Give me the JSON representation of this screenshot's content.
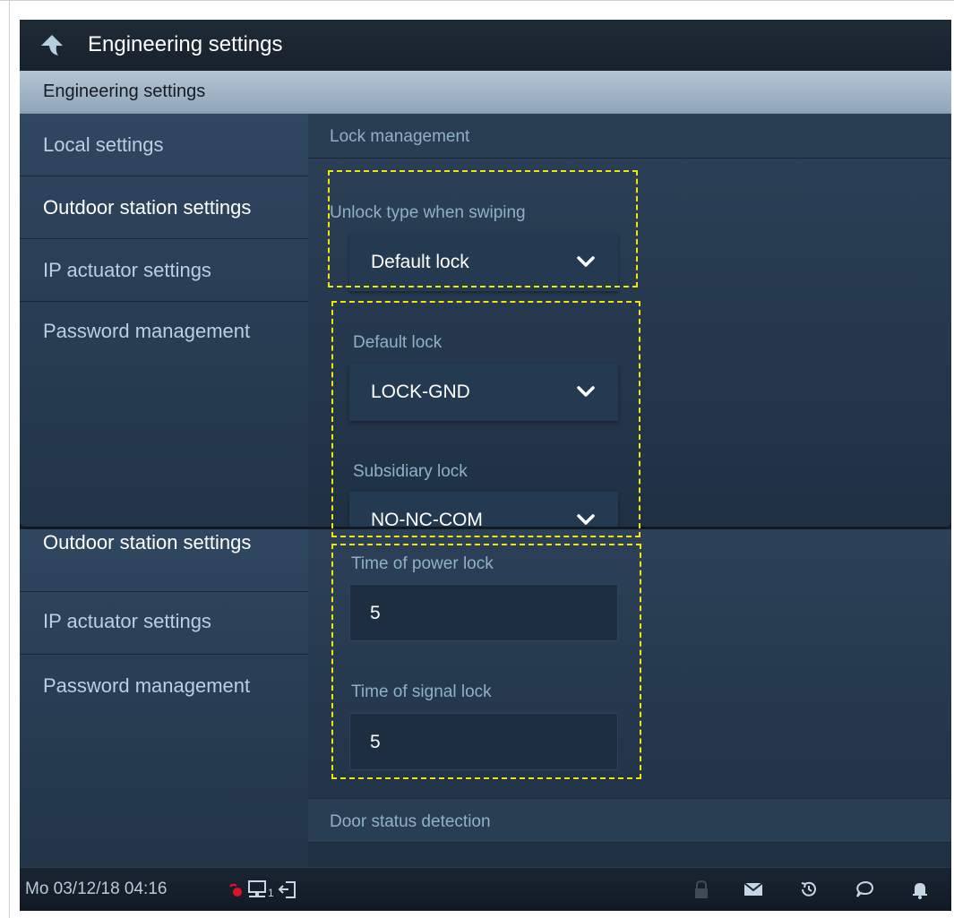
{
  "titlebar": {
    "title": "Engineering settings",
    "back_icon": "back-arrow-icon"
  },
  "section_header": {
    "label": "Engineering settings"
  },
  "sidebar_top": {
    "items": [
      {
        "label": "Local settings"
      },
      {
        "label": "Outdoor station settings",
        "active": true
      },
      {
        "label": "IP actuator settings"
      },
      {
        "label": "Password management"
      }
    ]
  },
  "content_top": {
    "group_header": "Lock management",
    "unlock_type": {
      "label": "Unlock type when swiping",
      "value": "Default lock"
    },
    "default_lock": {
      "label": "Default lock",
      "value": "LOCK-GND"
    },
    "subsidiary_lock": {
      "label": "Subsidiary lock",
      "value": "NO-NC-COM"
    }
  },
  "sidebar_bottom": {
    "items": [
      {
        "label": "Outdoor station settings",
        "active": true
      },
      {
        "label": "IP actuator settings"
      },
      {
        "label": "Password management"
      }
    ]
  },
  "content_bottom": {
    "power_lock": {
      "label": "Time of power lock",
      "value": "5"
    },
    "signal_lock": {
      "label": "Time of signal lock",
      "value": "5"
    },
    "group_header": "Door status detection"
  },
  "statusbar": {
    "datetime": "Mo 03/12/18  04:16",
    "network_index": "1",
    "icons_left": [
      "mute-icon",
      "network-icon",
      "exit-icon"
    ],
    "icons_right": [
      "lock-icon",
      "message-icon",
      "history-icon",
      "chat-icon",
      "bell-icon"
    ]
  },
  "colors": {
    "highlight_dash": "#f2e600",
    "header_bar": "#a3b8c9",
    "mute_indicator": "#e0102a"
  }
}
